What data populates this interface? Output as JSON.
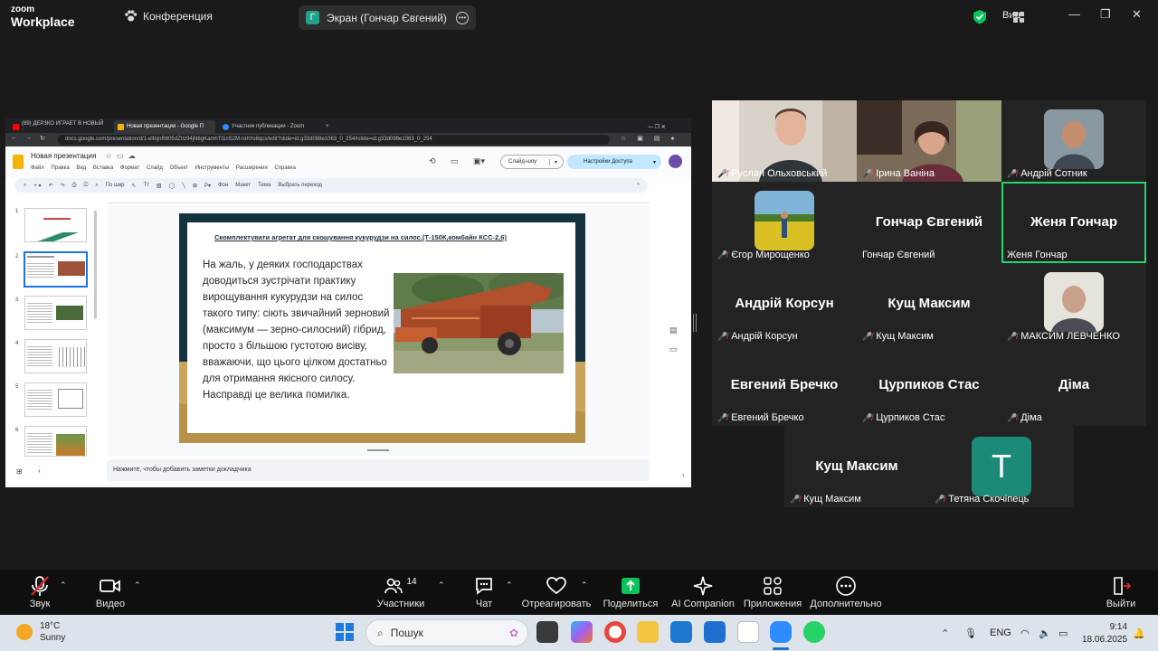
{
  "zoom": {
    "logo_line1": "zoom",
    "logo_line2": "Workplace",
    "meeting_label": "Конференция",
    "share_initial": "Г",
    "share_label": "Экран (Гончар Євгений)",
    "view_label": "Вид"
  },
  "browser": {
    "tabs": [
      {
        "label": "(89) ДЕРЗКО ИГРАЕТ В НОВЫЙ ·",
        "favicon_color": "#ff0000"
      },
      {
        "label": "Новая презентация - Google П",
        "favicon_color": "#f4b400"
      },
      {
        "label": "Участник публикации - Zoom",
        "favicon_color": "#2d8cff"
      }
    ],
    "url": "docs.google.com/presentation/d/1-elthjnR605dZtIz94jN8gKamhTt1nS2M-rohYo8qcs/edit?slide=id.g33d098e1063_0_254#slide=id.g33d098e1063_0_254"
  },
  "slides_app": {
    "doc_title": "Новая презентация",
    "menu": [
      "Файл",
      "Правка",
      "Вид",
      "Вставка",
      "Формат",
      "Слайд",
      "Объект",
      "Инструменты",
      "Расширения",
      "Справка"
    ],
    "slideshow_label": "Слайд-шоу",
    "access_label": "Настройки Доступа",
    "toolbar": {
      "zoom_label": "По шир",
      "background_label": "Фон",
      "layout_label": "Макет",
      "theme_label": "Тема",
      "transition_label": "Выбрать переход"
    },
    "thumbnails": [
      "1",
      "2",
      "3",
      "4",
      "5",
      "6"
    ],
    "notes_placeholder": "Нажмите, чтобы добавить заметки докладчика"
  },
  "slide": {
    "title": "Скомплектувати агрегат для скошування кукурудзи на силос.(Т-150К,комбайн КСС-2,6)",
    "body": "На жаль, у деяких господарствах доводиться зустрічати практику вирощування кукурудзи на силос такого типу: сіють звичайний зерновий (максимум — зерно-силосний) гібрид, просто з більшою густотою висіву, вважаючи, що цього цілком достатньо для отримання якісного силосу. Насправді це велика помилка."
  },
  "participants": [
    {
      "name": "Руслан Ольховський",
      "display": "",
      "has_video": true
    },
    {
      "name": "Ірина Ваніна",
      "display": "",
      "has_video": true
    },
    {
      "name": "Андрій Сотник",
      "display": "",
      "has_video": true
    },
    {
      "name": "Єгор Мирощенко",
      "display": "",
      "has_video": true
    },
    {
      "name": "Гончар Євгений",
      "display": "Гончар Євгений",
      "has_video": false
    },
    {
      "name": "Женя Гончар",
      "display": "Женя Гончар",
      "has_video": false
    },
    {
      "name": "Андрій Корсун",
      "display": "Андрій Корсун",
      "has_video": false
    },
    {
      "name": "Кущ Максим",
      "display": "Кущ Максим",
      "has_video": false
    },
    {
      "name": "МАКСИМ ЛЕВЧЕНКО",
      "display": "",
      "has_video": true
    },
    {
      "name": "Евгений Бречко",
      "display": "Евгений Бречко",
      "has_video": false
    },
    {
      "name": "Цурпиков Стас",
      "display": "Цурпиков Стас",
      "has_video": false
    },
    {
      "name": "Діма",
      "display": "Діма",
      "has_video": false
    },
    {
      "name": "Кущ Максим",
      "display": "Кущ Максим",
      "has_video": false
    },
    {
      "name": "Тетяна Скочіпець",
      "display": "T",
      "has_video": false
    }
  ],
  "controls": {
    "audio": "Звук",
    "video": "Видео",
    "participants": "Участники",
    "participants_count": "14",
    "chat": "Чат",
    "react": "Отреагировать",
    "share": "Поделиться",
    "ai": "AI Companion",
    "apps": "Приложения",
    "more": "Дополнительно",
    "leave": "Выйти"
  },
  "taskbar": {
    "temp": "18°C",
    "weather": "Sunny",
    "search": "Пошук",
    "lang": "ENG",
    "time": "9:14",
    "date": "18.06.2025"
  },
  "colors": {
    "active_speaker": "#23d96b",
    "muted": "#ff4a4a",
    "share_green": "#0ac35a",
    "leave_red": "#e02828"
  }
}
